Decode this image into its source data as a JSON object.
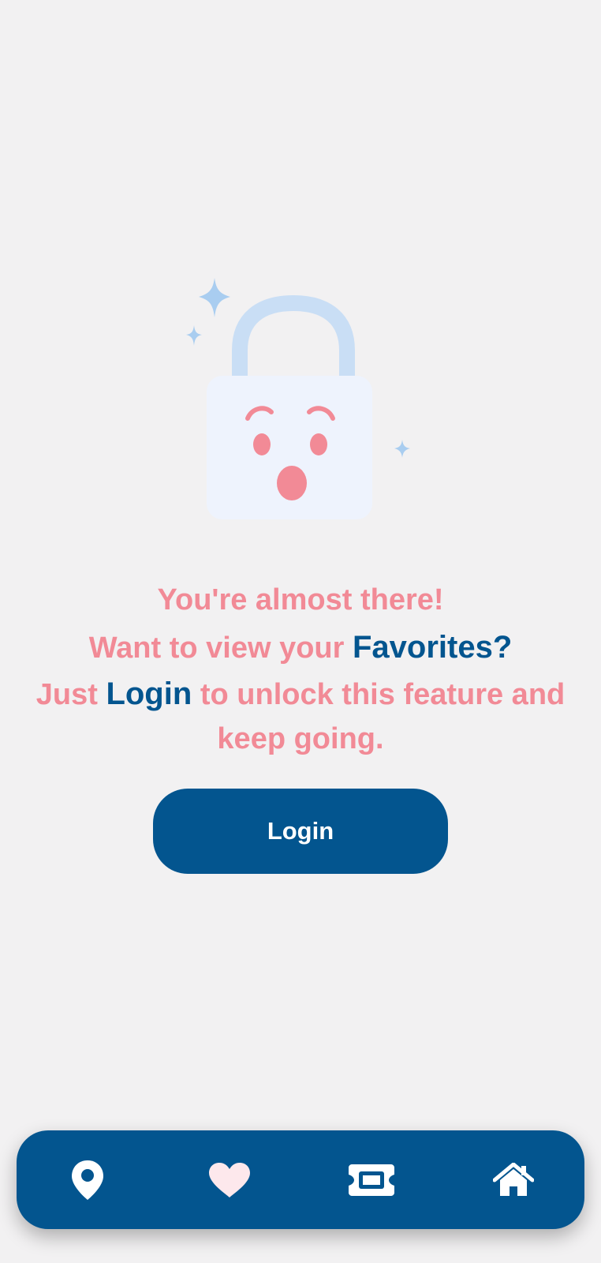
{
  "message": {
    "line1": "You're almost there!",
    "line2_prefix": "Want to view your ",
    "line2_accent": "Favorites?",
    "line3_prefix": "Just ",
    "line3_accent": "Login",
    "line3_suffix": " to unlock this feature and keep going."
  },
  "login_button": {
    "label": "Login"
  },
  "bottom_nav": {
    "items": [
      {
        "icon": "location-pin-icon",
        "selected": false
      },
      {
        "icon": "heart-icon",
        "selected": true
      },
      {
        "icon": "ticket-icon",
        "selected": false
      },
      {
        "icon": "home-icon",
        "selected": false
      }
    ]
  },
  "colors": {
    "background": "#f2f1f2",
    "primary": "#03558f",
    "accent_pink": "#f28a96",
    "lock_body": "#eef3fd",
    "lock_shackle": "#c9def5",
    "sparkle": "#a9cdf0",
    "heart_selected": "#fde8ec"
  }
}
